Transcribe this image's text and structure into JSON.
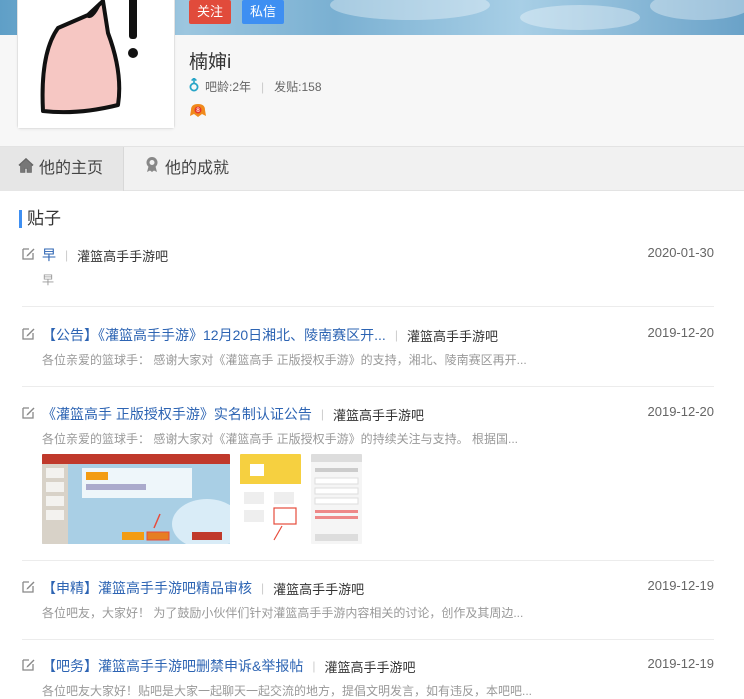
{
  "profile": {
    "follow_label": "关注",
    "message_label": "私信",
    "username": "楠婶i",
    "age_label": "吧龄:2年",
    "posts_label": "发贴:158"
  },
  "tabs": [
    {
      "label": "他的主页"
    },
    {
      "label": "他的成就"
    }
  ],
  "section": {
    "title": "贴子"
  },
  "posts": [
    {
      "title": "早",
      "forum": "灌篮高手手游吧",
      "date": "2020-01-30",
      "excerpt": "早"
    },
    {
      "title": "【公告】《灌篮高手手游》12月20日湘北、陵南赛区开...",
      "forum": "灌篮高手手游吧",
      "date": "2019-12-20",
      "excerpt": "各位亲爱的篮球手：  感谢大家对《灌篮高手 正版授权手游》的支持，湘北、陵南赛区再开..."
    },
    {
      "title": "《灌篮高手 正版授权手游》实名制认证公告",
      "forum": "灌篮高手手游吧",
      "date": "2019-12-20",
      "excerpt": "各位亲爱的篮球手：  感谢大家对《灌篮高手 正版授权手游》的持续关注与支持。 根据国..."
    },
    {
      "title": "【申精】灌篮高手手游吧精品审核",
      "forum": "灌篮高手手游吧",
      "date": "2019-12-19",
      "excerpt": "各位吧友，大家好！  为了鼓励小伙伴们针对灌篮高手手游内容相关的讨论，创作及其周边..."
    },
    {
      "title": "【吧务】灌篮高手手游吧删禁申诉&举报帖",
      "forum": "灌篮高手手游吧",
      "date": "2019-12-19",
      "excerpt": "各位吧友大家好！贴吧是大家一起聊天一起交流的地方，提倡文明发言，如有违反，本吧吧..."
    }
  ],
  "colors": {
    "accent": "#3e8ff2",
    "follow": "#e14b3b",
    "link": "#2d64b3"
  }
}
